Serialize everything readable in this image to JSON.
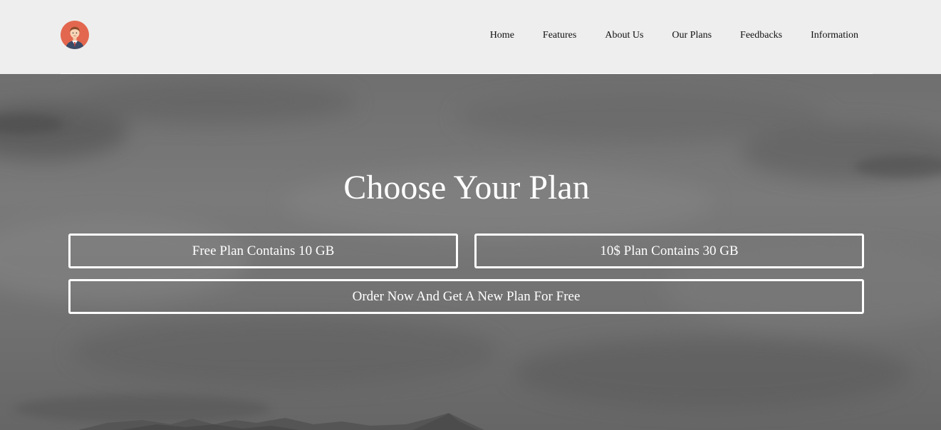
{
  "header": {
    "logo_icon": "user-avatar-icon",
    "nav": [
      {
        "label": "Home"
      },
      {
        "label": "Features"
      },
      {
        "label": "About Us"
      },
      {
        "label": "Our Plans"
      },
      {
        "label": "Feedbacks"
      },
      {
        "label": "Information"
      }
    ]
  },
  "hero": {
    "title": "Choose Your Plan",
    "buttons": {
      "free": "Free Plan Contains 10 GB",
      "paid": "10$ Plan Contains 30 GB",
      "order": "Order Now And Get A New Plan For Free"
    }
  },
  "colors": {
    "header_bg": "#eeeeee",
    "avatar_circle": "#e2674e",
    "hero_text": "#ffffff"
  }
}
